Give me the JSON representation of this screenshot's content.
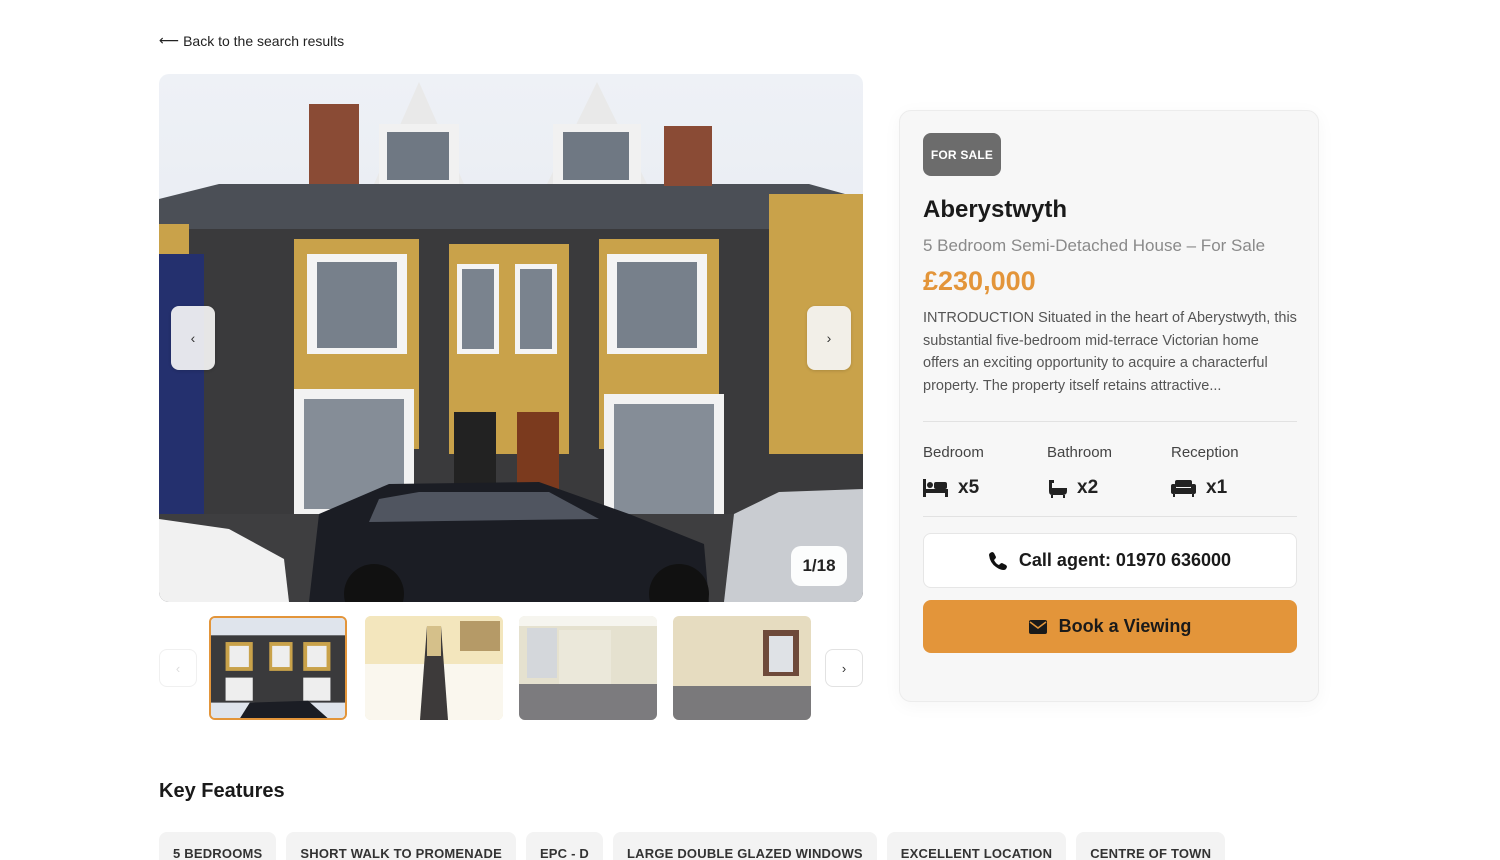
{
  "back_link": {
    "arrow": "⟵",
    "label": "Back to the search results"
  },
  "gallery": {
    "prev_label": "‹",
    "next_label": "›",
    "counter": "1/18",
    "thumb_prev_label": "‹",
    "thumb_next_label": "›",
    "thumbnails": [
      {
        "alt": "house-front",
        "active": true
      },
      {
        "alt": "hallway-stairs",
        "active": false
      },
      {
        "alt": "empty-room-bay-window",
        "active": false
      },
      {
        "alt": "empty-room-window",
        "active": false
      }
    ]
  },
  "listing": {
    "badge": "FOR SALE",
    "town": "Aberystwyth",
    "subtitle": "5 Bedroom Semi-Detached House – For Sale",
    "price": "£230,000",
    "description": "INTRODUCTION Situated in the heart of Aberystwyth, this substantial five-bedroom mid-terrace Victorian home offers an exciting opportunity to acquire a characterful property. The property itself retains attractive...",
    "stats": [
      {
        "label": "Bedroom",
        "value": "x5",
        "icon": "bed-icon"
      },
      {
        "label": "Bathroom",
        "value": "x2",
        "icon": "bath-icon"
      },
      {
        "label": "Reception",
        "value": "x1",
        "icon": "sofa-icon"
      }
    ],
    "call_label": "Call agent: 01970 636000",
    "book_label": "Book a Viewing"
  },
  "key_features": {
    "title": "Key Features",
    "items": [
      "5 BEDROOMS",
      "SHORT WALK TO PROMENADE",
      "EPC - D",
      "LARGE DOUBLE GLAZED WINDOWS",
      "EXCELLENT LOCATION",
      "CENTRE OF TOWN"
    ]
  },
  "colors": {
    "accent": "#e3953a",
    "badge": "#6c6c6c",
    "card_bg": "#f7f7f7"
  }
}
